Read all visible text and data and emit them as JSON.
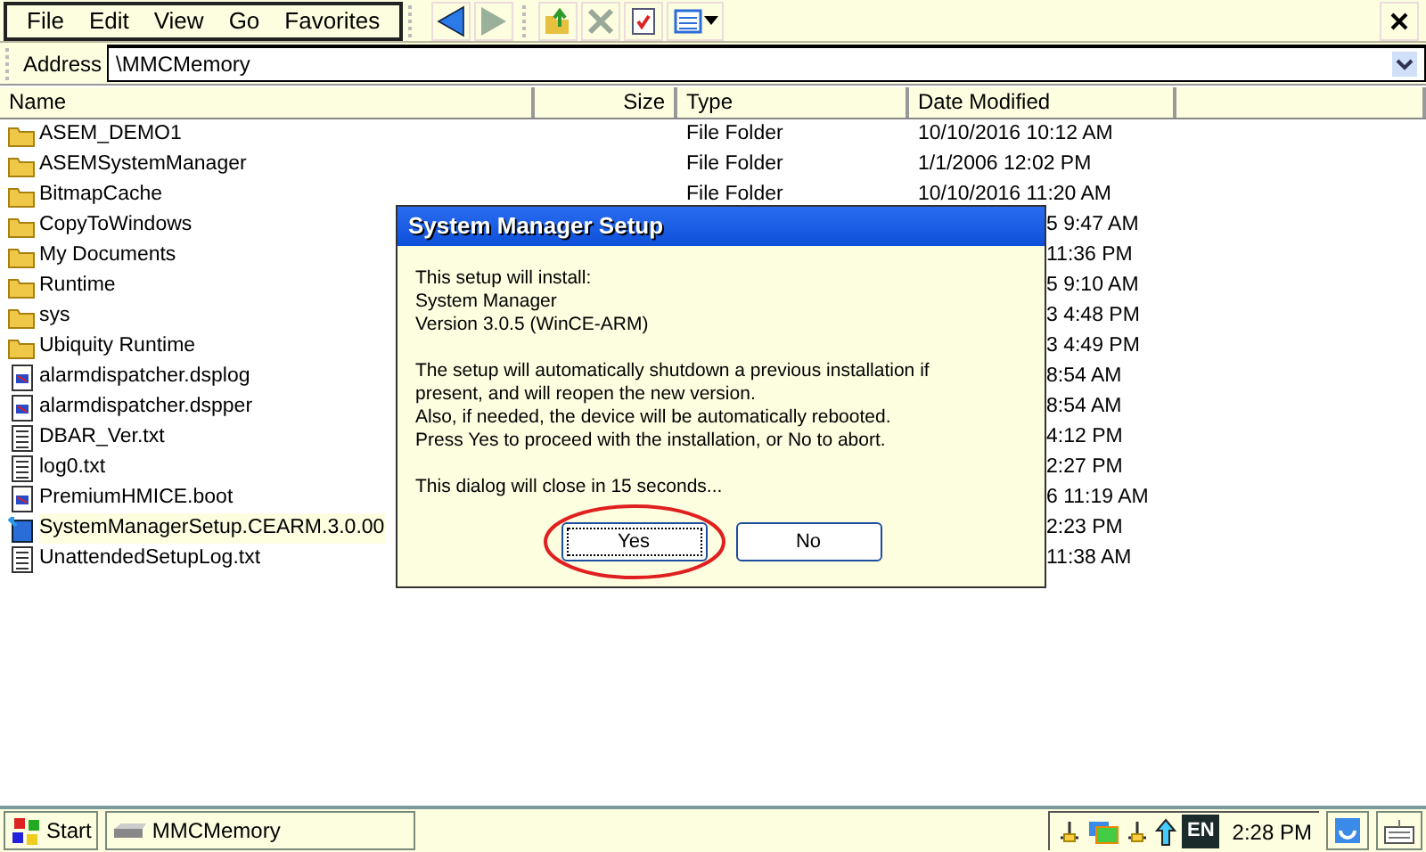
{
  "menu": [
    "File",
    "Edit",
    "View",
    "Go",
    "Favorites"
  ],
  "address": {
    "label": "Address",
    "value": "\\MMCMemory"
  },
  "columns": [
    "Name",
    "Size",
    "Type",
    "Date Modified"
  ],
  "rows": [
    {
      "kind": "folder",
      "name": "ASEM_DEMO1",
      "type": "File Folder",
      "date": "10/10/2016 10:12 AM",
      "selected": false
    },
    {
      "kind": "folder",
      "name": "ASEMSystemManager",
      "type": "File Folder",
      "date": "1/1/2006 12:02 PM",
      "selected": false
    },
    {
      "kind": "folder",
      "name": "BitmapCache",
      "type": "File Folder",
      "date": "10/10/2016 11:20 AM",
      "selected": false
    },
    {
      "kind": "folder",
      "name": "CopyToWindows",
      "date": "5 9:47 AM",
      "selected": false
    },
    {
      "kind": "folder",
      "name": "My Documents",
      "date": "11:36 PM",
      "selected": false
    },
    {
      "kind": "folder",
      "name": "Runtime",
      "date": "5 9:10 AM",
      "selected": false
    },
    {
      "kind": "folder",
      "name": "sys",
      "date": "3 4:48 PM",
      "selected": false
    },
    {
      "kind": "folder",
      "name": "Ubiquity Runtime",
      "date": "3 4:49 PM",
      "selected": false
    },
    {
      "kind": "data",
      "name": "alarmdispatcher.dsplog",
      "date": "8:54 AM",
      "selected": false
    },
    {
      "kind": "data",
      "name": "alarmdispatcher.dspper",
      "date": "8:54 AM",
      "selected": false
    },
    {
      "kind": "text",
      "name": "DBAR_Ver.txt",
      "date": "4:12 PM",
      "selected": false
    },
    {
      "kind": "text",
      "name": "log0.txt",
      "date": "2:27 PM",
      "selected": false
    },
    {
      "kind": "data",
      "name": "PremiumHMICE.boot",
      "date": "6 11:19 AM",
      "selected": false
    },
    {
      "kind": "setup",
      "name": "SystemManagerSetup.CEARM.3.0.00",
      "date": "2:23 PM",
      "selected": true
    },
    {
      "kind": "text",
      "name": "UnattendedSetupLog.txt",
      "date": "11:38 AM",
      "selected": false
    }
  ],
  "dialog": {
    "title": "System Manager Setup",
    "paragraphs": [
      "This setup will install:\nSystem Manager\nVersion 3.0.5 (WinCE-ARM)",
      "The setup will automatically shutdown a previous installation if\npresent, and will reopen the new version.\nAlso, if needed, the device will be automatically rebooted.\nPress Yes to proceed with the installation, or No to abort.",
      "This dialog will close in 15 seconds..."
    ],
    "buttons": [
      {
        "label": "Yes",
        "focused": true,
        "circled": true
      },
      {
        "label": "No",
        "focused": false,
        "circled": false
      }
    ]
  },
  "taskbar": {
    "start": "Start",
    "tasks": [
      "MMCMemory"
    ],
    "language": "EN",
    "time": "2:28 PM"
  }
}
